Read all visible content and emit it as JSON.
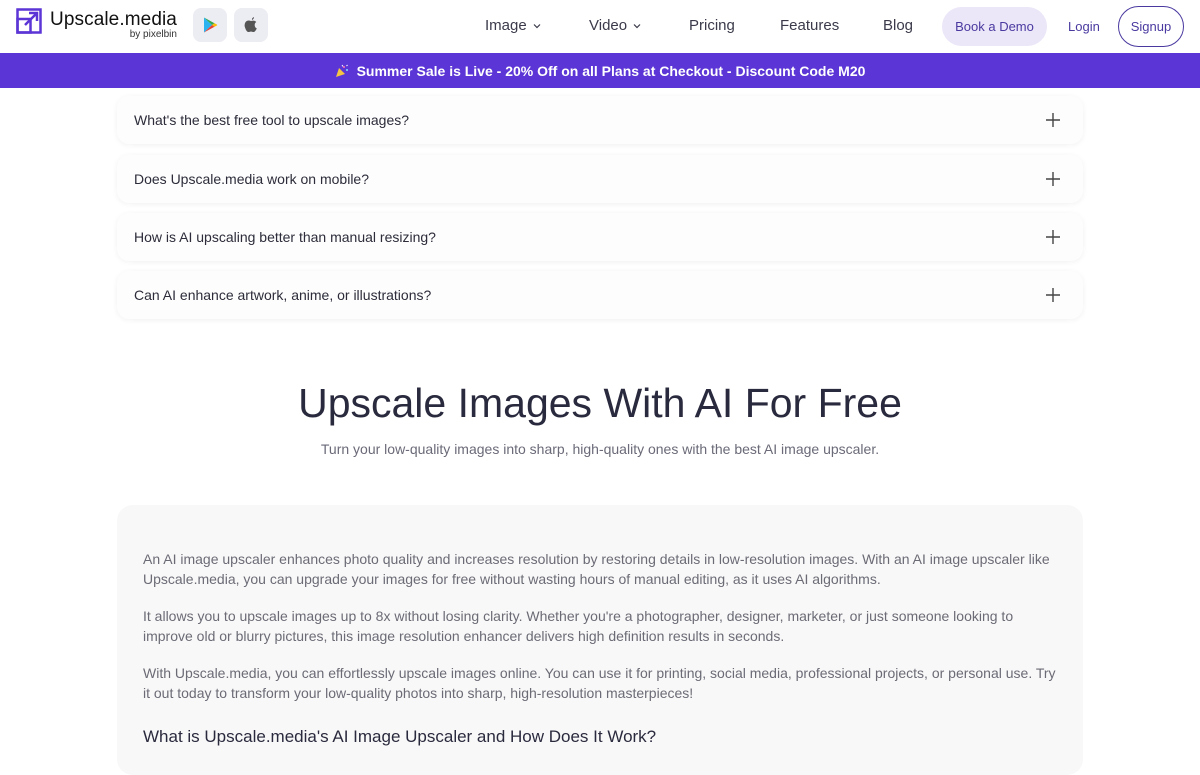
{
  "header": {
    "logo_title": "Upscale.media",
    "logo_sub": "by pixelbin",
    "store_buttons": [
      "google-play-icon",
      "apple-icon"
    ],
    "nav": [
      {
        "label": "Image",
        "has_dropdown": true
      },
      {
        "label": "Video",
        "has_dropdown": true
      },
      {
        "label": "Pricing",
        "has_dropdown": false
      },
      {
        "label": "Features",
        "has_dropdown": false
      },
      {
        "label": "Blog",
        "has_dropdown": false
      }
    ],
    "demo_label": "Book a Demo",
    "login_label": "Login",
    "signup_label": "Signup"
  },
  "banner": {
    "icon": "party-popper-icon",
    "text": "Summer Sale is Live - 20% Off on all Plans at Checkout - Discount Code M20"
  },
  "faq": [
    "What's the best free tool to upscale images?",
    "Does Upscale.media work on mobile?",
    "How is AI upscaling better than manual resizing?",
    "Can AI enhance artwork, anime, or illustrations?"
  ],
  "hero": {
    "title": "Upscale Images With AI For Free",
    "subtitle": "Turn your low-quality images into sharp, high-quality ones with the best AI image upscaler."
  },
  "content": {
    "paragraphs": [
      "An AI image upscaler enhances photo quality and increases resolution by restoring details in low-resolution images. With an AI image upscaler like Upscale.media, you can upgrade your images for free without wasting hours of manual editing, as it uses AI algorithms.",
      "It allows you to upscale images up to 8x without losing clarity. Whether you're a photographer, designer, marketer, or just someone looking to improve old or blurry pictures, this image resolution enhancer delivers high definition results in seconds.",
      "With Upscale.media, you can effortlessly upscale images online. You can use it for printing, social media, professional projects, or personal use. Try it out today to transform your low-quality photos into sharp, high-resolution masterpieces!"
    ],
    "next_heading": "What is Upscale.media's AI Image Upscaler and How Does It Work?"
  },
  "colors": {
    "brand": "#5b35d5",
    "accent_text": "#4a3aa0",
    "demo_bg": "#ebe6f8"
  }
}
